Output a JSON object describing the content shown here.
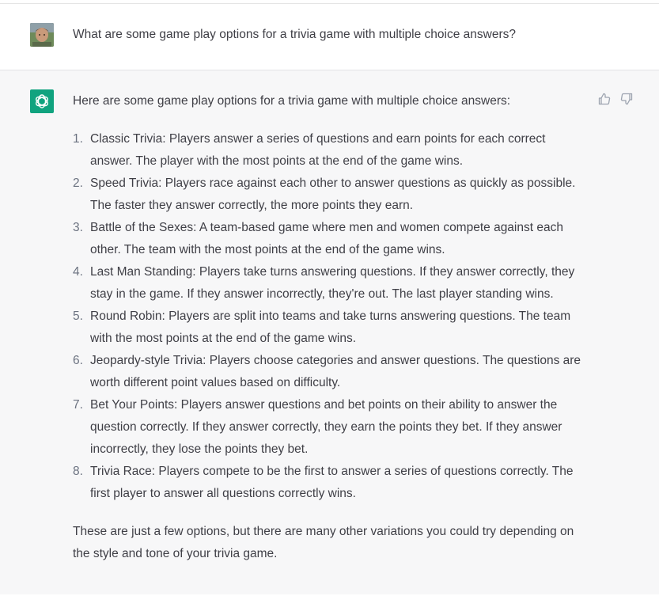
{
  "user_message": {
    "text": "What are some game play options for a trivia game with multiple choice answers?"
  },
  "assistant_message": {
    "intro": "Here are some game play options for a trivia game with multiple choice answers:",
    "items": [
      {
        "num": "1.",
        "text": "Classic Trivia: Players answer a series of questions and earn points for each correct answer. The player with the most points at the end of the game wins."
      },
      {
        "num": "2.",
        "text": "Speed Trivia: Players race against each other to answer questions as quickly as possible. The faster they answer correctly, the more points they earn."
      },
      {
        "num": "3.",
        "text": "Battle of the Sexes: A team-based game where men and women compete against each other. The team with the most points at the end of the game wins."
      },
      {
        "num": "4.",
        "text": "Last Man Standing: Players take turns answering questions. If they answer correctly, they stay in the game. If they answer incorrectly, they're out. The last player standing wins."
      },
      {
        "num": "5.",
        "text": "Round Robin: Players are split into teams and take turns answering questions. The team with the most points at the end of the game wins."
      },
      {
        "num": "6.",
        "text": "Jeopardy-style Trivia: Players choose categories and answer questions. The questions are worth different point values based on difficulty."
      },
      {
        "num": "7.",
        "text": "Bet Your Points: Players answer questions and bet points on their ability to answer the question correctly. If they answer correctly, they earn the points they bet. If they answer incorrectly, they lose the points they bet."
      },
      {
        "num": "8.",
        "text": "Trivia Race: Players compete to be the first to answer a series of questions correctly. The first player to answer all questions correctly wins."
      }
    ],
    "outro": "These are just a few options, but there are many other variations you could try depending on the style and tone of your trivia game."
  },
  "icons": {
    "user_avatar": "user-avatar-photo",
    "assistant_avatar": "openai-logo-icon",
    "thumbs_up": "thumbs-up-icon",
    "thumbs_down": "thumbs-down-icon"
  },
  "colors": {
    "assistant_bg": "#f7f7f8",
    "logo_bg": "#10a37f",
    "text": "#3f3f46",
    "icon": "#9ca3af"
  }
}
